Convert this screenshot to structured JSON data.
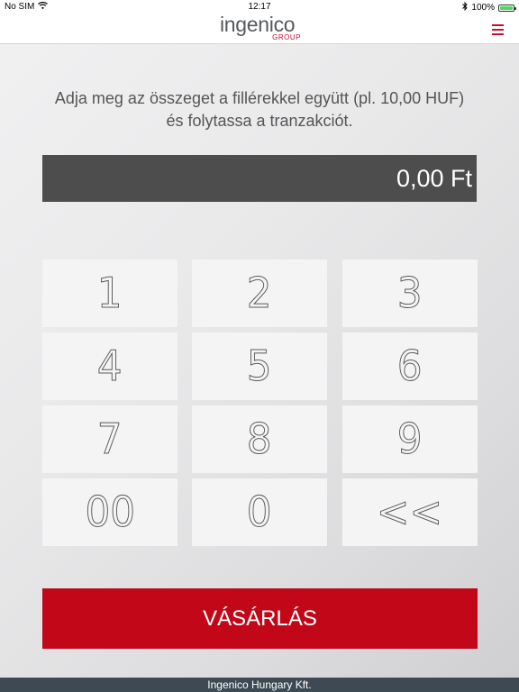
{
  "status_bar": {
    "carrier": "No SIM",
    "time": "12:17",
    "battery_text": "100%",
    "battery_level": 1.0
  },
  "header": {
    "logo_word": "ingenico",
    "logo_sub": "GROUP",
    "brand_color": "#c8102e"
  },
  "instruction": {
    "line1": "Adja meg az összeget a fillérekkel együtt (pl. 10,00 HUF)",
    "line2": "és folytassa a tranzakciót."
  },
  "amount": {
    "value": "0,00 Ft"
  },
  "keypad": {
    "keys": [
      "1",
      "2",
      "3",
      "4",
      "5",
      "6",
      "7",
      "8",
      "9",
      "00",
      "0",
      "<<"
    ]
  },
  "buy_button": {
    "label": "VÁSÁRLÁS",
    "color": "#c10718"
  },
  "footer": {
    "text": "Ingenico Hungary Kft."
  }
}
